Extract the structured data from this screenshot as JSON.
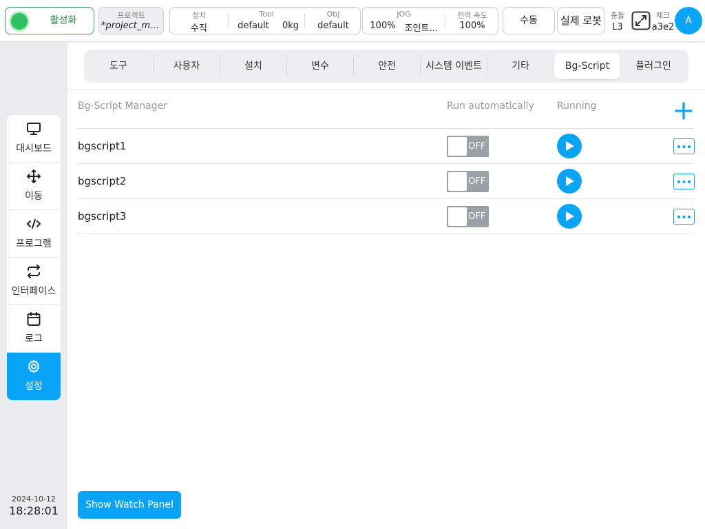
{
  "colors": {
    "accent": "#0aa4f6",
    "enabled_green": "#2fbf61",
    "toggle_off": "#9aa0a6"
  },
  "topbar": {
    "enable_label": "활성화",
    "project": {
      "title": "프로젝트",
      "value": "*project_mo…"
    },
    "settings": {
      "install": {
        "title": "설치",
        "value": "수직"
      },
      "tool": {
        "title": "Tool",
        "value": "default",
        "weight": "0kg"
      },
      "obj": {
        "title": "Obj",
        "value": "default"
      }
    },
    "jog": {
      "title": "JOG",
      "speed": "100%",
      "mode": "조인트…"
    },
    "global_speed": {
      "title": "전역 속도",
      "value": "100%"
    },
    "mode_label": "수동",
    "robot_label": "실제 로봇",
    "collision": {
      "title": "충돌",
      "value": "L3"
    },
    "check": {
      "title": "체크",
      "value": "a3e2"
    },
    "avatar_letter": "A"
  },
  "sidebar": {
    "items": [
      {
        "label": "대시보드",
        "icon": "monitor-icon"
      },
      {
        "label": "이동",
        "icon": "move-arrows-icon"
      },
      {
        "label": "프로그램",
        "icon": "code-icon"
      },
      {
        "label": "인터페이스",
        "icon": "swap-arrows-icon"
      },
      {
        "label": "로그",
        "icon": "calendar-icon"
      },
      {
        "label": "설정",
        "icon": "gear-icon",
        "active": true
      }
    ],
    "date": "2024-10-12",
    "time": "18:28:01"
  },
  "tabs": [
    {
      "label": "도구"
    },
    {
      "label": "사용자"
    },
    {
      "label": "설치"
    },
    {
      "label": "변수"
    },
    {
      "label": "안전"
    },
    {
      "label": "시스템 이벤트"
    },
    {
      "label": "기타"
    },
    {
      "label": "Bg-Script",
      "active": true
    },
    {
      "label": "플러그인"
    }
  ],
  "manager": {
    "headers": {
      "name": "Bg-Script Manager",
      "auto": "Run automatically",
      "running": "Running"
    },
    "rows": [
      {
        "name": "bgscript1",
        "auto": "OFF"
      },
      {
        "name": "bgscript2",
        "auto": "OFF"
      },
      {
        "name": "bgscript3",
        "auto": "OFF"
      }
    ]
  },
  "watch_panel_label": "Show Watch Panel"
}
